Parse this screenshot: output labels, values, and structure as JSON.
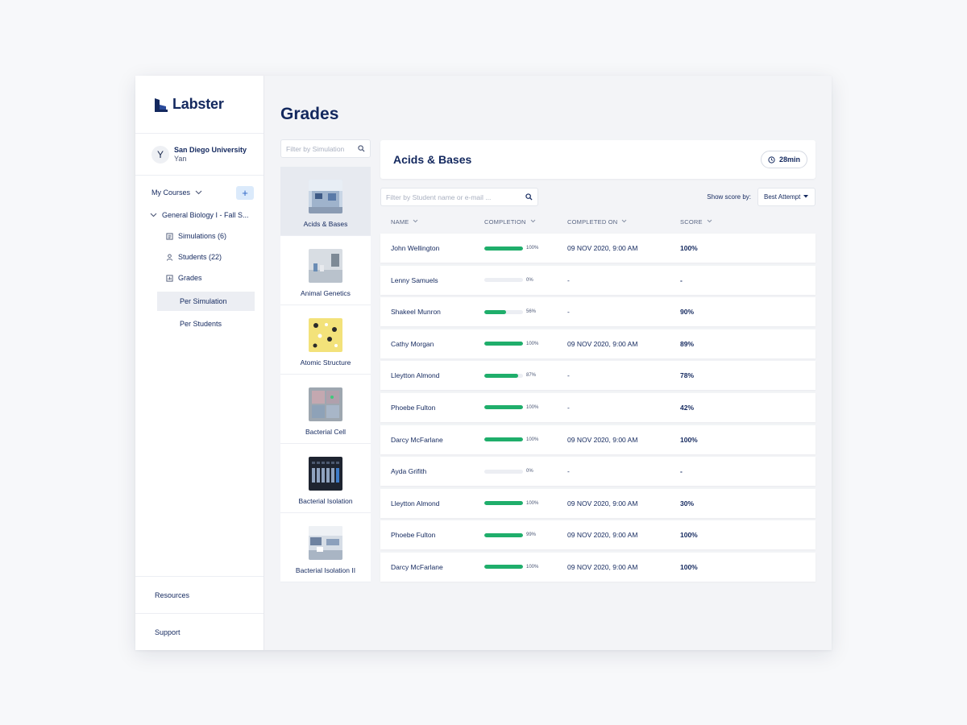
{
  "brand": {
    "name": "Labster"
  },
  "org": {
    "avatar_letter": "Y",
    "name": "San Diego University",
    "user": "Yan"
  },
  "sidebar": {
    "my_courses_label": "My Courses",
    "add_label": "+",
    "course_title": "General Biology I - Fall S...",
    "items": [
      {
        "label": "Simulations (6)",
        "icon": "simulations-icon"
      },
      {
        "label": "Students (22)",
        "icon": "student-icon"
      },
      {
        "label": "Grades",
        "icon": "chart-icon"
      }
    ],
    "grades_sub": [
      {
        "label": "Per Simulation",
        "active": true
      },
      {
        "label": "Per Students",
        "active": false
      }
    ],
    "bottom": {
      "resources": "Resources",
      "support": "Support"
    }
  },
  "page": {
    "title": "Grades"
  },
  "simulation_filter": {
    "placeholder": "Filter by Simulation",
    "value": ""
  },
  "simulations": [
    {
      "name": "Acids & Bases",
      "active": true,
      "thumb": "lab"
    },
    {
      "name": "Animal Genetics",
      "active": false,
      "thumb": "lab2"
    },
    {
      "name": "Atomic Structure",
      "active": false,
      "thumb": "atom"
    },
    {
      "name": "Bacterial Cell",
      "active": false,
      "thumb": "cell"
    },
    {
      "name": "Bacterial Isolation",
      "active": false,
      "thumb": "dark"
    },
    {
      "name": "Bacterial Isolation II",
      "active": false,
      "thumb": "lab3"
    }
  ],
  "panel": {
    "title": "Acids & Bases",
    "duration": "28min",
    "student_filter": {
      "placeholder": "Filter by Student name or e-mail ...",
      "value": ""
    },
    "show_score_label": "Show score by:",
    "score_select": "Best Attempt",
    "columns": {
      "name": "NAME",
      "completion": "COMPLETION",
      "completed_on": "COMPLETED ON",
      "score": "SCORE"
    }
  },
  "rows": [
    {
      "name": "John Wellington",
      "completion": 100,
      "completion_label": "100%",
      "completed_on": "09 NOV 2020, 9:00 AM",
      "score": "100%"
    },
    {
      "name": "Lenny Samuels",
      "completion": 0,
      "completion_label": "0%",
      "completed_on": "-",
      "score": "-"
    },
    {
      "name": "Shakeel Munron",
      "completion": 56,
      "completion_label": "56%",
      "completed_on": "-",
      "score": "90%"
    },
    {
      "name": "Cathy Morgan",
      "completion": 100,
      "completion_label": "100%",
      "completed_on": "09 NOV 2020, 9:00 AM",
      "score": "89%"
    },
    {
      "name": "Lleytton Almond",
      "completion": 87,
      "completion_label": "87%",
      "completed_on": "-",
      "score": "78%"
    },
    {
      "name": "Phoebe Fulton",
      "completion": 100,
      "completion_label": "100%",
      "completed_on": "-",
      "score": "42%"
    },
    {
      "name": "Darcy McFarlane",
      "completion": 100,
      "completion_label": "100%",
      "completed_on": "09 NOV 2020, 9:00 AM",
      "score": "100%"
    },
    {
      "name": "Ayda Grifith",
      "completion": 0,
      "completion_label": "0%",
      "completed_on": "-",
      "score": "-"
    },
    {
      "name": "Lleytton Almond",
      "completion": 100,
      "completion_label": "100%",
      "completed_on": "09 NOV 2020, 9:00 AM",
      "score": "30%"
    },
    {
      "name": "Phoebe Fulton",
      "completion": 99,
      "completion_label": "99%",
      "completed_on": "09 NOV 2020, 9:00 AM",
      "score": "100%"
    },
    {
      "name": "Darcy McFarlane",
      "completion": 100,
      "completion_label": "100%",
      "completed_on": "09 NOV 2020, 9:00 AM",
      "score": "100%"
    }
  ],
  "colors": {
    "accent": "#1fae6b",
    "navy": "#13285e",
    "add_button_bg": "#dbeafb"
  }
}
